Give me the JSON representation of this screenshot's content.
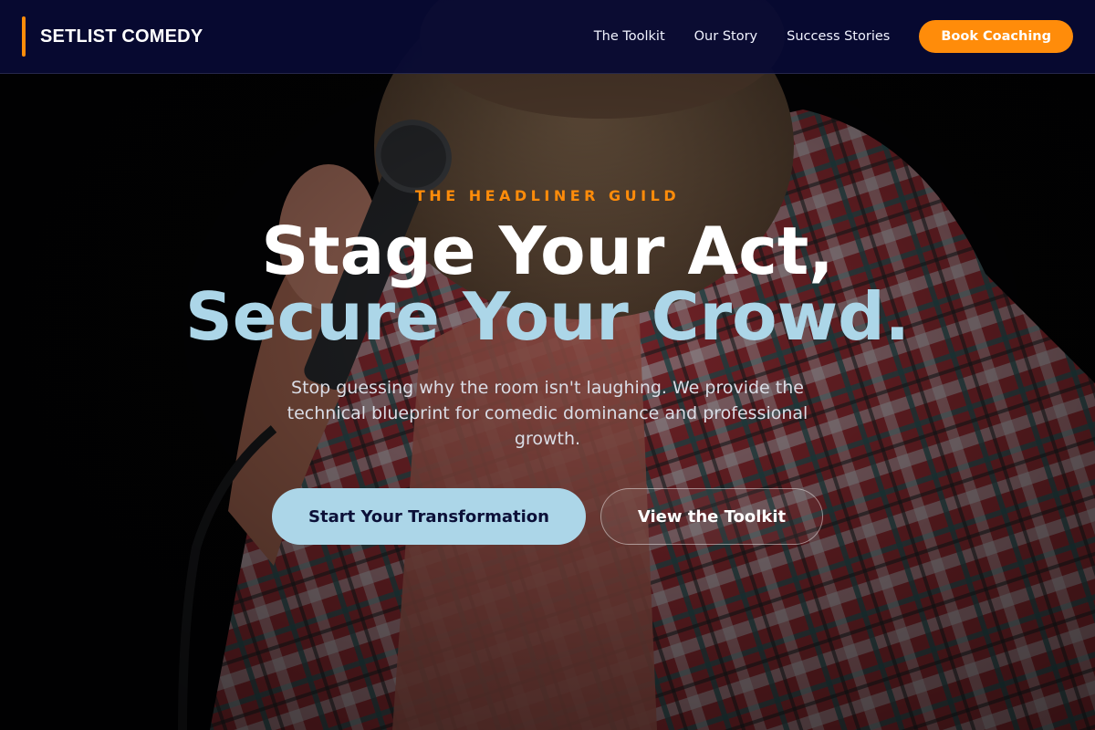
{
  "header": {
    "brand_name": "SETLIST COMEDY",
    "nav": [
      {
        "label": "The Toolkit"
      },
      {
        "label": "Our Story"
      },
      {
        "label": "Success Stories"
      }
    ],
    "cta_label": "Book Coaching"
  },
  "hero": {
    "eyebrow": "THE HEADLINER GUILD",
    "headline_line1": "Stage Your Act,",
    "headline_line2": "Secure Your Crowd.",
    "subtext": "Stop guessing why the room isn't laughing. We provide the technical blueprint for comedic dominance and professional growth.",
    "primary_button": "Start Your Transformation",
    "secondary_button": "View the Toolkit"
  },
  "colors": {
    "accent_orange": "#ff8c0a",
    "accent_light_blue": "#acd6e8",
    "header_navy": "#080a34"
  }
}
